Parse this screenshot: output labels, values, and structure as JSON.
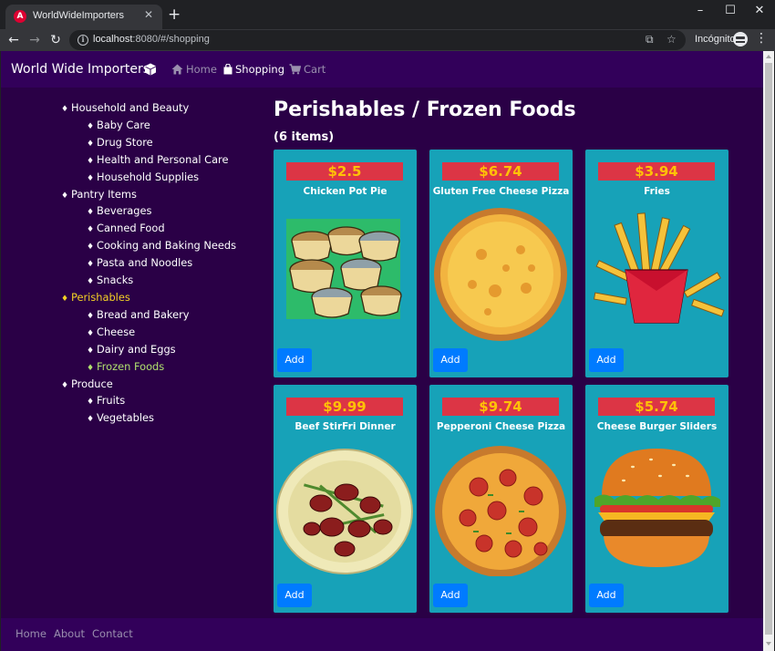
{
  "browser": {
    "tab_title": "WorldWideImporters",
    "url_host": "localhost",
    "url_rest": ":8080/#/shopping",
    "incognito_label": "Incógnito"
  },
  "navbar": {
    "brand": "World Wide Importers",
    "links": [
      "Home",
      "Shopping",
      "Cart"
    ],
    "active_link": "Shopping"
  },
  "categories": {
    "groups": [
      {
        "label": "Household and Beauty",
        "children": [
          "Baby Care",
          "Drug Store",
          "Health and Personal Care",
          "Household Supplies"
        ]
      },
      {
        "label": "Pantry Items",
        "children": [
          "Beverages",
          "Canned Food",
          "Cooking and Baking Needs",
          "Pasta and Noodles",
          "Snacks"
        ]
      },
      {
        "label": "Perishables",
        "children": [
          "Bread and Bakery",
          "Cheese",
          "Dairy and Eggs",
          "Frozen Foods"
        ]
      },
      {
        "label": "Produce",
        "children": [
          "Fruits",
          "Vegetables"
        ]
      }
    ],
    "selected_group": "Perishables",
    "selected_child": "Frozen Foods"
  },
  "main": {
    "title": "Perishables / Frozen Foods",
    "count": "(6 items)"
  },
  "products": [
    {
      "price": "$2.5",
      "name": "Chicken Pot Pie",
      "image": "chicken-pot-pie-image",
      "add_label": "Add"
    },
    {
      "price": "$6.74",
      "name": "Gluten Free Cheese Pizza",
      "image": "cheese-pizza-image",
      "add_label": "Add"
    },
    {
      "price": "$3.94",
      "name": "Fries",
      "image": "fries-image",
      "add_label": "Add"
    },
    {
      "price": "$9.99",
      "name": "Beef StirFri Dinner",
      "image": "beef-stirfry-image",
      "add_label": "Add"
    },
    {
      "price": "$9.74",
      "name": "Pepperoni Cheese Pizza",
      "image": "pepperoni-pizza-image",
      "add_label": "Add"
    },
    {
      "price": "$5.74",
      "name": "Cheese Burger Sliders",
      "image": "burger-image",
      "add_label": "Add"
    }
  ],
  "footer": {
    "links": [
      "Home",
      "About",
      "Contact"
    ]
  },
  "colors": {
    "page_bg": "#2a0046",
    "navbar_bg": "#32005a",
    "card_bg": "#17a2b8",
    "price_bg": "#dc3545",
    "price_text": "#ffc107",
    "add_button": "#007bff",
    "selected_group": "#f4d125",
    "selected_child": "#b0e06e"
  }
}
